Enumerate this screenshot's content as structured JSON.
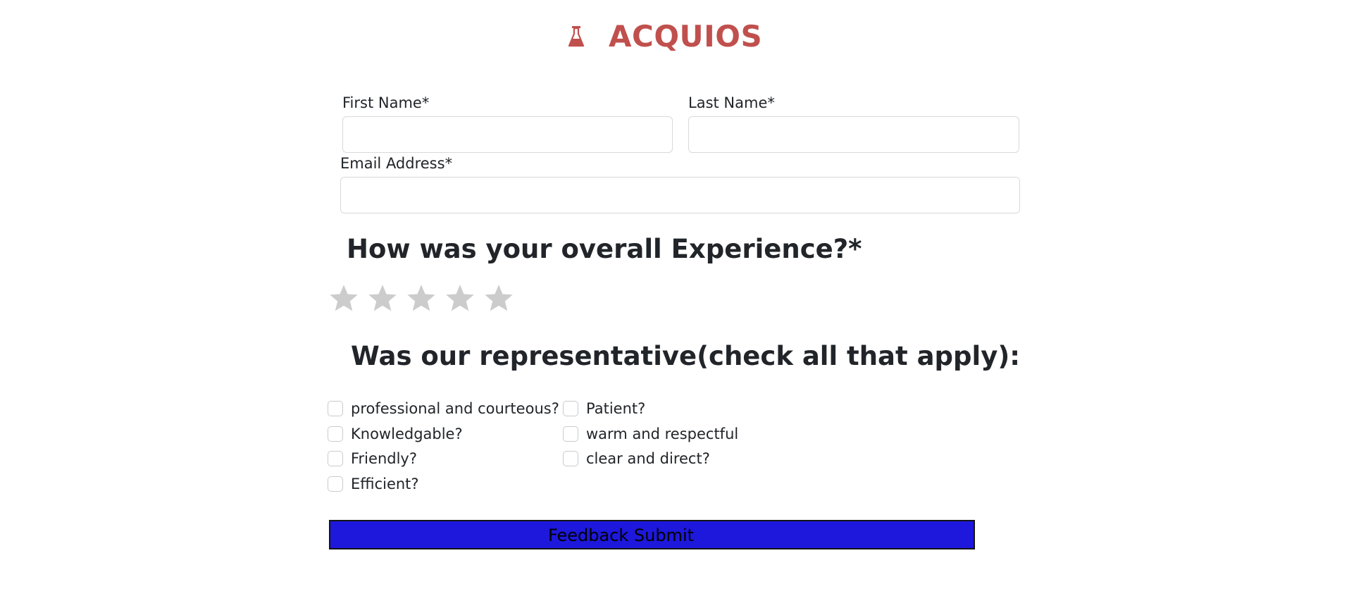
{
  "brand": {
    "name": "ACQUIOS",
    "icon": "flask-icon",
    "color": "#c0504d"
  },
  "form": {
    "first_name_label": "First Name*",
    "first_name_value": "",
    "last_name_label": "Last Name*",
    "last_name_value": "",
    "email_label": "Email Address*",
    "email_value": ""
  },
  "experience": {
    "heading": "How was your overall Experience?*",
    "rating": 0,
    "max_rating": 5,
    "star_color": "#cccccc"
  },
  "representative": {
    "heading": "Was our representative(check all that apply):",
    "options": [
      {
        "label": "professional and courteous?",
        "checked": false
      },
      {
        "label": "Knowledgable?",
        "checked": false
      },
      {
        "label": "Friendly?",
        "checked": false
      },
      {
        "label": "Efficient?",
        "checked": false
      },
      {
        "label": "Patient?",
        "checked": false
      },
      {
        "label": "warm and respectful",
        "checked": false
      },
      {
        "label": "clear and direct?",
        "checked": false
      }
    ]
  },
  "submit": {
    "label": "Feedback Submit",
    "color": "#1d18dc"
  }
}
